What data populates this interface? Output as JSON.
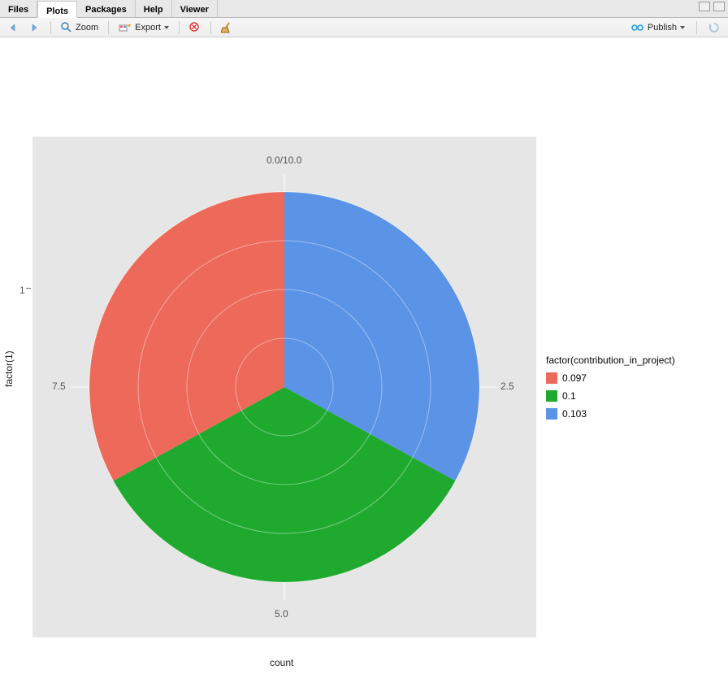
{
  "tabs": {
    "files": "Files",
    "plots": "Plots",
    "packages": "Packages",
    "help": "Help",
    "viewer": "Viewer",
    "active": "Plots"
  },
  "toolbar": {
    "zoom": "Zoom",
    "export": "Export",
    "publish": "Publish"
  },
  "axes": {
    "y_label": "factor(1)",
    "x_label": "count",
    "ticks": {
      "top": "0.0/10.0",
      "right_inner": "2.5",
      "bottom": "5.0",
      "left_inner": "7.5",
      "y1": "1"
    }
  },
  "legend": {
    "title": "factor(contribution_in_project)",
    "items": [
      {
        "label": "0.097",
        "color": "#ed6a5a"
      },
      {
        "label": "0.1",
        "color": "#1faa2f"
      },
      {
        "label": "0.103",
        "color": "#5b93e6"
      }
    ]
  },
  "chart_data": {
    "type": "pie",
    "title": "",
    "xlabel": "count",
    "ylabel": "factor(1)",
    "legend_title": "factor(contribution_in_project)",
    "radial_ticks": [
      0.0,
      2.5,
      5.0,
      7.5,
      10.0
    ],
    "series": [
      {
        "name": "0.103",
        "value": 3.233,
        "label": "0.103",
        "color": "#5b93e6"
      },
      {
        "name": "0.1",
        "value": 3.333,
        "label": "0.1",
        "color": "#1faa2f"
      },
      {
        "name": "0.097",
        "value": 3.233,
        "label": "0.097",
        "color": "#ed6a5a"
      }
    ]
  }
}
